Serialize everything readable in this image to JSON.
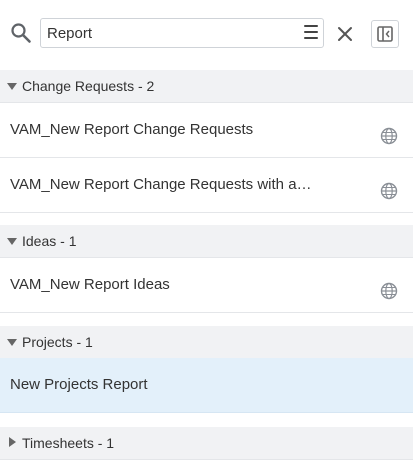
{
  "search": {
    "value": "Report",
    "icons": {
      "search": "search-icon",
      "menu": "menu-icon",
      "clear": "close-icon",
      "sidebar_toggle": "sidebar-toggle-icon"
    }
  },
  "groups": [
    {
      "title": "Change Requests - 2",
      "expanded": true,
      "items": [
        {
          "label": "VAM_New Report Change Requests",
          "icon": "globe-icon",
          "selected": false
        },
        {
          "label": "VAM_New Report Change Requests with a…",
          "icon": "globe-icon",
          "selected": false
        }
      ]
    },
    {
      "title": "Ideas - 1",
      "expanded": true,
      "items": [
        {
          "label": "VAM_New Report Ideas",
          "icon": "globe-icon",
          "selected": false
        }
      ]
    },
    {
      "title": "Projects - 1",
      "expanded": true,
      "items": [
        {
          "label": "New Projects Report",
          "icon": null,
          "selected": true
        }
      ]
    },
    {
      "title": "Timesheets - 1",
      "expanded": false,
      "items": []
    }
  ],
  "colors": {
    "group_header_bg": "#f1f2f4",
    "selected_bg": "#e3f0fa",
    "border": "#e4e6e9",
    "text": "#333333",
    "icon": "#8a8f96"
  }
}
